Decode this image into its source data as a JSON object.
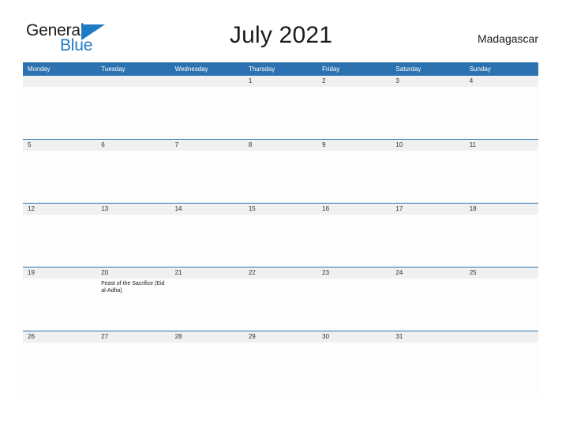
{
  "logo": {
    "word_top": "General",
    "word_bottom": "Blue",
    "accent_color": "#1f7ac4"
  },
  "header": {
    "title": "July 2021",
    "country": "Madagascar"
  },
  "theme": {
    "header_blue": "#2d72b0",
    "number_band_gray": "#f0f0f0",
    "rule_blue": "#2d72b0",
    "text_dark": "#1b1b1b"
  },
  "calendar": {
    "month": "July",
    "year": "2021",
    "weekday_headers": [
      "Monday",
      "Tuesday",
      "Wednesday",
      "Thursday",
      "Friday",
      "Saturday",
      "Sunday"
    ],
    "weeks": [
      {
        "row_index": 0,
        "days": [
          {
            "number": "",
            "event": ""
          },
          {
            "number": "",
            "event": ""
          },
          {
            "number": "",
            "event": ""
          },
          {
            "number": "1",
            "event": ""
          },
          {
            "number": "2",
            "event": ""
          },
          {
            "number": "3",
            "event": ""
          },
          {
            "number": "4",
            "event": ""
          }
        ]
      },
      {
        "row_index": 1,
        "days": [
          {
            "number": "5",
            "event": ""
          },
          {
            "number": "6",
            "event": ""
          },
          {
            "number": "7",
            "event": ""
          },
          {
            "number": "8",
            "event": ""
          },
          {
            "number": "9",
            "event": ""
          },
          {
            "number": "10",
            "event": ""
          },
          {
            "number": "11",
            "event": ""
          }
        ]
      },
      {
        "row_index": 2,
        "days": [
          {
            "number": "12",
            "event": ""
          },
          {
            "number": "13",
            "event": ""
          },
          {
            "number": "14",
            "event": ""
          },
          {
            "number": "15",
            "event": ""
          },
          {
            "number": "16",
            "event": ""
          },
          {
            "number": "17",
            "event": ""
          },
          {
            "number": "18",
            "event": ""
          }
        ]
      },
      {
        "row_index": 3,
        "days": [
          {
            "number": "19",
            "event": ""
          },
          {
            "number": "20",
            "event": "Feast of the Sacrifice (Eid al-Adha)"
          },
          {
            "number": "21",
            "event": ""
          },
          {
            "number": "22",
            "event": ""
          },
          {
            "number": "23",
            "event": ""
          },
          {
            "number": "24",
            "event": ""
          },
          {
            "number": "25",
            "event": ""
          }
        ]
      },
      {
        "row_index": 4,
        "days": [
          {
            "number": "26",
            "event": ""
          },
          {
            "number": "27",
            "event": ""
          },
          {
            "number": "28",
            "event": ""
          },
          {
            "number": "29",
            "event": ""
          },
          {
            "number": "30",
            "event": ""
          },
          {
            "number": "31",
            "event": ""
          },
          {
            "number": "",
            "event": ""
          }
        ]
      }
    ]
  }
}
